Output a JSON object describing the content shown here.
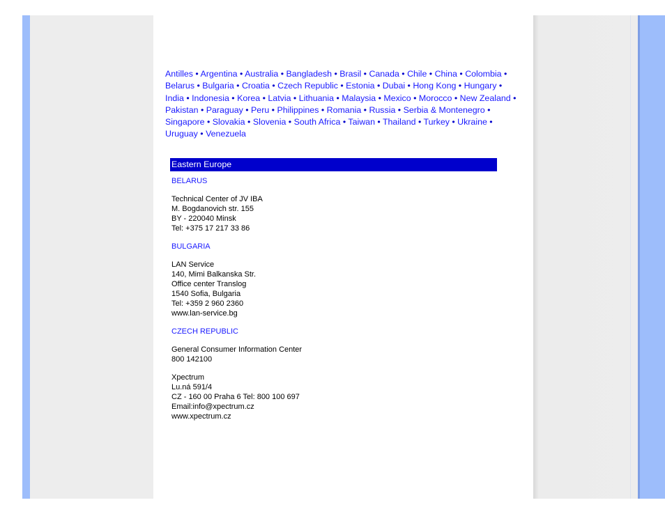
{
  "countries": [
    "Antilles",
    "Argentina",
    "Australia",
    "Bangladesh",
    "Brasil",
    "Canada",
    "Chile",
    "China",
    "Colombia",
    "Belarus",
    "Bulgaria",
    "Croatia",
    "Czech Republic",
    "Estonia",
    "Dubai",
    "Hong Kong",
    "Hungary",
    "India",
    "Indonesia",
    "Korea",
    "Latvia",
    "Lithuania",
    "Malaysia",
    "Mexico",
    "Morocco",
    "New Zealand",
    "Pakistan",
    "Paraguay",
    "Peru",
    "Philippines",
    "Romania",
    "Russia",
    "Serbia & Montenegro",
    "Singapore",
    "Slovakia",
    "Slovenia",
    "South Africa",
    "Taiwan",
    "Thailand",
    "Turkey",
    "Ukraine",
    "Uruguay",
    "Venezuela"
  ],
  "separator": "•",
  "region": {
    "title": "Eastern Europe"
  },
  "entries": [
    {
      "country": "BELARUS",
      "blocks": [
        [
          "Technical Center of JV IBA",
          "M. Bogdanovich str. 155",
          "BY - 220040 Minsk",
          "Tel: +375 17 217 33 86"
        ]
      ]
    },
    {
      "country": "BULGARIA",
      "blocks": [
        [
          "LAN Service",
          "140, Mimi Balkanska Str.",
          "Office center Translog",
          "1540 Sofia, Bulgaria",
          "Tel: +359 2 960 2360",
          "www.lan-service.bg"
        ]
      ]
    },
    {
      "country": "CZECH REPUBLIC",
      "blocks": [
        [
          "General Consumer Information Center",
          "800 142100"
        ],
        [
          "Xpectrum",
          "Lu.ná 591/4",
          "CZ - 160 00 Praha 6 Tel: 800 100 697",
          "Email:info@xpectrum.cz",
          "www.xpectrum.cz"
        ]
      ]
    }
  ],
  "colors": {
    "link": "#1a1aff",
    "region_bar": "#0000cc",
    "frame_blue": "#9dbdfb",
    "frame_gray": "#ededed"
  }
}
